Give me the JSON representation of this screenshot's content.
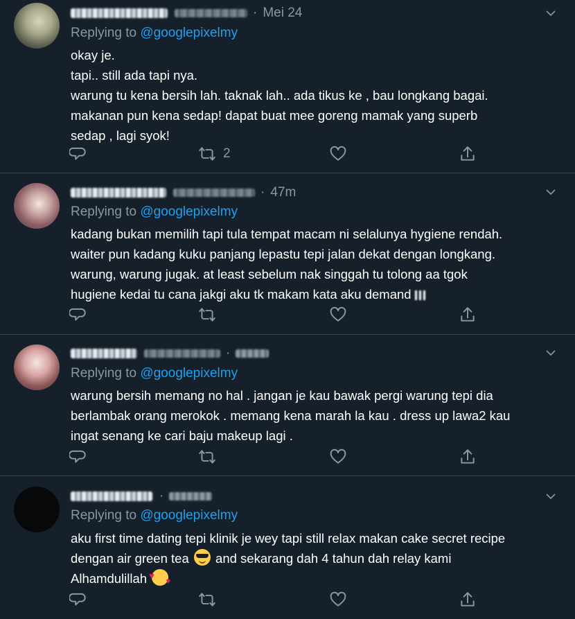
{
  "tweets": [
    {
      "time": "Mei 24",
      "replying_prefix": "Replying to",
      "mention": "@googlepixelmy",
      "lines": [
        "okay je.",
        "tapi.. still ada tapi nya.",
        "warung tu kena bersih lah. taknak lah.. ada tikus ke , bau longkang bagai.",
        "makanan pun kena sedap! dapat buat mee goreng mamak yang superb",
        "sedap , lagi syok!"
      ],
      "retweet_count": "2",
      "like_count": "",
      "reply_count": ""
    },
    {
      "time": "47m",
      "replying_prefix": "Replying to",
      "mention": "@googlepixelmy",
      "lines": [
        "kadang bukan memilih tapi tula tempat macam ni selalunya hygiene rendah.",
        "waiter pun kadang kuku panjang lepastu tepi jalan dekat dengan longkang.",
        "warung, warung jugak. at least sebelum nak singgah tu tolong aa tgok",
        "hugiene kedai tu cana jakgi aku tk makam kata aku demand"
      ],
      "retweet_count": "",
      "like_count": "",
      "reply_count": ""
    },
    {
      "time": "",
      "replying_prefix": "Replying to",
      "mention": "@googlepixelmy",
      "lines": [
        "warung bersih memang no hal . jangan je kau bawak pergi warung tepi dia",
        "berlambak orang merokok . memang kena marah la kau . dress up lawa2 kau",
        "ingat senang ke cari baju makeup lagi ."
      ],
      "retweet_count": "",
      "like_count": "",
      "reply_count": ""
    },
    {
      "time": "",
      "replying_prefix": "Replying to",
      "mention": "@googlepixelmy",
      "line1": "aku first time dating tepi klinik je wey tapi still relax makan cake secret recipe",
      "line2a": "dengan air green tea",
      "line2b": "and sekarang dah 4 tahun dah relay kami",
      "line3": "Alhamdulillah",
      "retweet_count": "",
      "like_count": "",
      "reply_count": ""
    }
  ],
  "icons": {
    "reply": "reply-icon",
    "retweet": "retweet-icon",
    "like": "heart-icon",
    "share": "share-icon",
    "more": "chevron-down-icon",
    "emoji_cool": "smiling-face-with-sunglasses-icon",
    "emoji_hearts": "smiling-face-with-hearts-icon"
  },
  "colors": {
    "background": "#15202b",
    "divider": "#38444d",
    "text": "#ffffff",
    "muted": "#8899a6",
    "link": "#1da1f2"
  }
}
